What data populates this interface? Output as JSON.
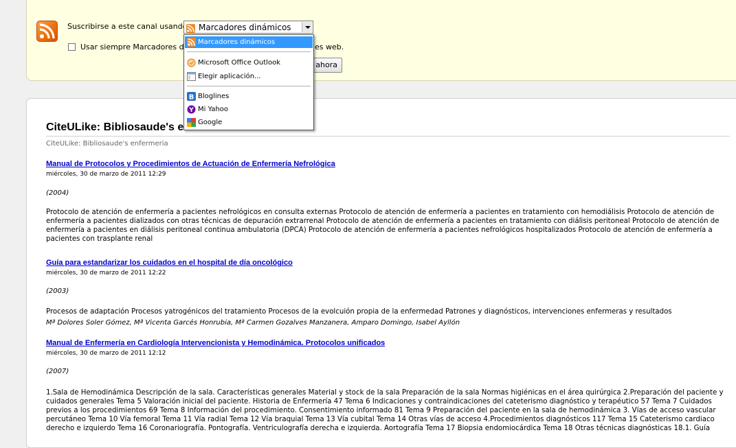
{
  "subscribe": {
    "label": "Suscribirse a este canal usando",
    "selected": "Marcadores dinámicos",
    "always_prefix": "Usar siempre Marcadores di",
    "always_suffix": "es web.",
    "button_label": "ahora"
  },
  "dropdown": {
    "items": [
      {
        "label": "Marcadores dinámicos",
        "icon": "rss-icon"
      },
      {
        "label": "Microsoft Office Outlook",
        "icon": "outlook-icon"
      },
      {
        "label": "Elegir aplicación...",
        "icon": "application-icon"
      },
      {
        "label": "Bloglines",
        "icon": "bloglines-icon"
      },
      {
        "label": "Mi Yahoo",
        "icon": "yahoo-icon"
      },
      {
        "label": "Google",
        "icon": "google-icon"
      }
    ]
  },
  "feed": {
    "title": "CiteULike: Bibliosaude's enfermeria",
    "subtitle": "CiteULike: Bibliosaude's enfermeria"
  },
  "items": [
    {
      "title": "Manual de Protocolos y Procedimientos de Actuación de Enfermería Nefrológica",
      "date": "miércoles, 30 de marzo de 2011 12:29",
      "year": "(2004)",
      "description": "Protocolo de atención de enfermería a pacientes nefrológicos en consulta externas Protocolo de atención de enfermería a pacientes en tratamiento con hemodiálisis Protocolo de atención de enfermería a pacientes dializados con otras técnicas de depuración extrarrenal Protocolo de atención de enfermería a pacientes en tratamiento con diálisis peritoneal Protocolo de atención de enfermería a pacientes en diálisis peritoneal continua ambulatoria (DPCA) Protocolo de atención de enfermería a pacientes nefrológicos hospitalizados Protocolo de atención de enfermería a pacientes con trasplante renal"
    },
    {
      "title": "Guía para estandarizar los cuidados en el hospital de día oncológico",
      "date": "miércoles, 30 de marzo de 2011 12:22",
      "year": "(2003)",
      "description": "Procesos de adaptación Procesos yatrogénicos del tratamiento Procesos de la evolcuión propia de la enfermedad Patrones y diagnósticos, intervenciones enfermeras y resultados",
      "authors": "Mª Dolores Soler Gómez, Mª Vicenta Garcés Honrubia, Mª Carmen Gozalves Manzanera, Amparo Domingo, Isabel Ayllón"
    },
    {
      "title": "Manual de Enfermería en Cardiología Intervencionista y Hemodinámica. Protocolos unificados",
      "date": "miércoles, 30 de marzo de 2011 12:12",
      "year": "(2007)",
      "description": "1.Sala de Hemodinámica Descripción de la sala. Características generales Material y stock de la sala Preparación de la sala Normas higiénicas en el área quirúrgica 2.Preparación del paciente y cuidados generales Tema 5 Valoración inicial del paciente. Historia de Enfermería 47 Tema 6 Indicaciones y contraindicaciones del cateterismo diagnóstico y terapéutico 57 Tema 7 Cuidados previos a los procedimientos 69 Tema 8 Información del procedimiento. Consentimiento informado 81 Tema 9 Preparación del paciente en la sala de hemodinámica 3. Vías de acceso vascular percutáneo Tema 10 Vía femoral Tema 11 Vía radial Tema 12 Vía braquial Tema 13 Vía cubital Tema 14 Otras vías de acceso 4.Procedimientos diagnósticos 117 Tema 15 Cateterismo cardiaco derecho e izquierdo Tema 16 Coronariografía. Pontografía. Ventriculografía derecha e izquierda. Aortografía Tema 17 Biopsia endomiocárdica Tema 18 Otras técnicas diagnósticas 18.1. Guía"
    }
  ]
}
